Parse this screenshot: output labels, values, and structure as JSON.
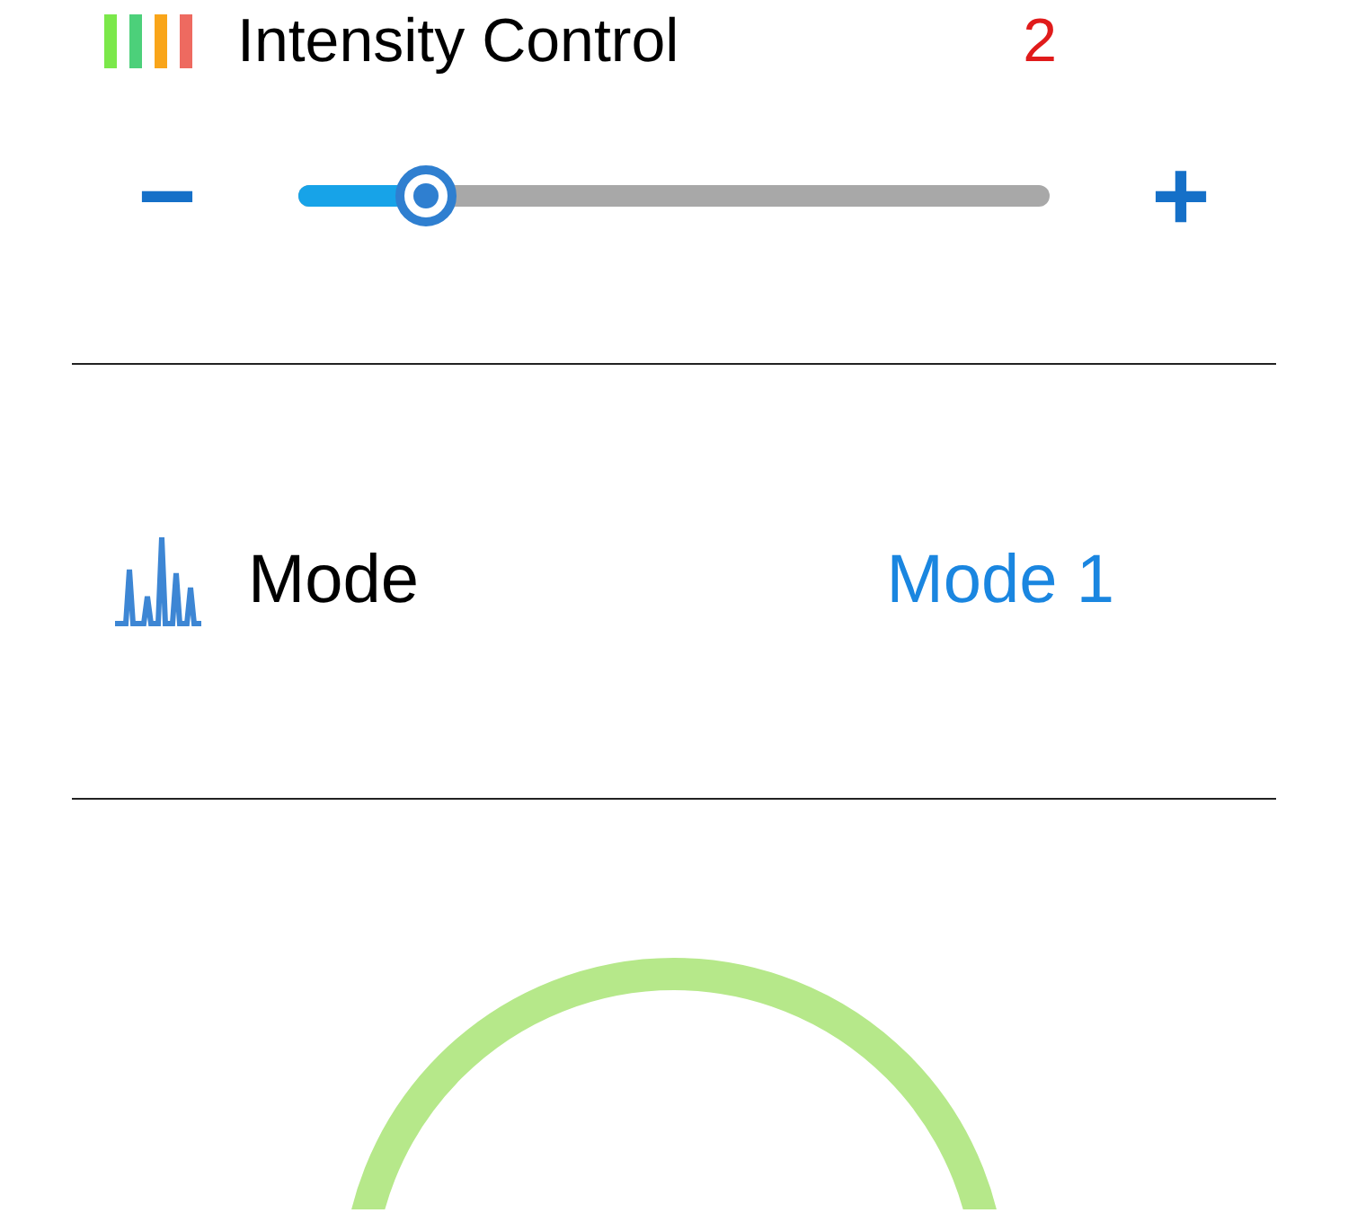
{
  "intensity": {
    "title": "Intensity Control",
    "value": "2",
    "minus": "−",
    "plus": "+",
    "level": 0.17
  },
  "mode": {
    "label": "Mode",
    "value": "Mode 1"
  }
}
